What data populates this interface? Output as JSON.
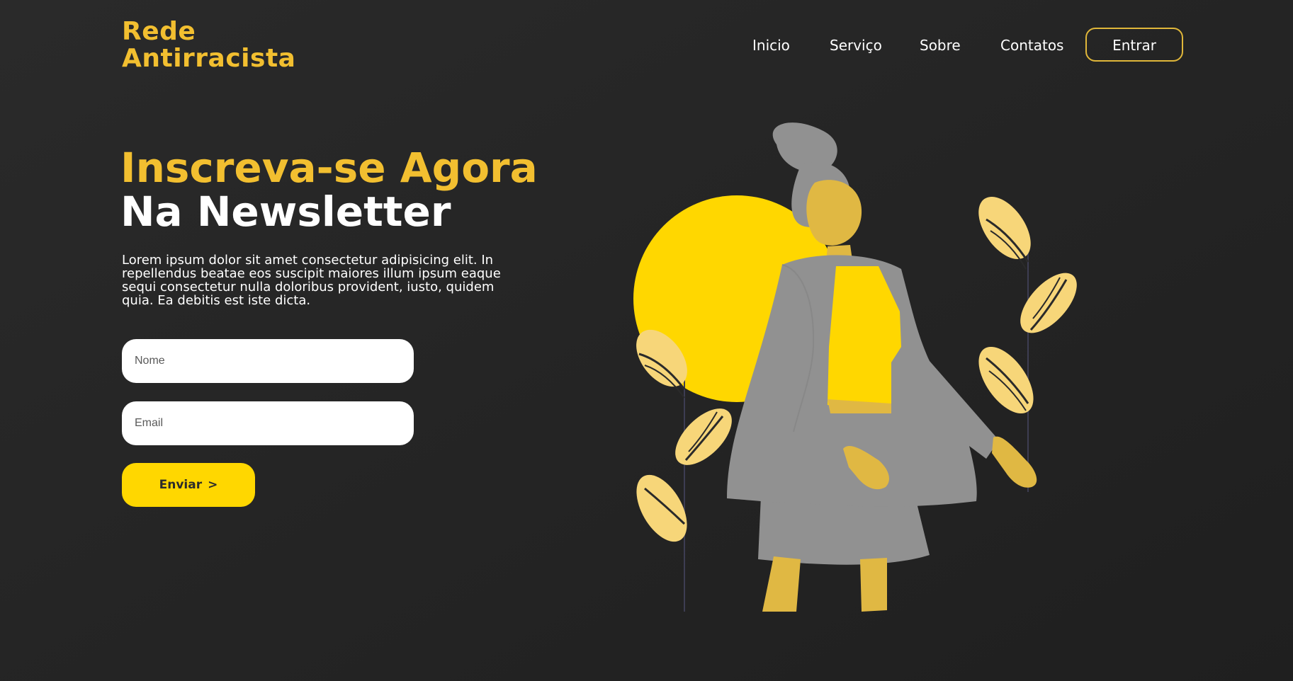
{
  "brand": {
    "line1": "Rede",
    "line2": "Antirracista"
  },
  "nav": {
    "items": [
      {
        "label": "Inicio"
      },
      {
        "label": "Serviço"
      },
      {
        "label": "Sobre"
      },
      {
        "label": "Contatos"
      }
    ],
    "login_label": "Entrar"
  },
  "hero": {
    "title_line1": "Inscreva-se Agora",
    "title_line2": "Na Newsletter",
    "description": "Lorem ipsum dolor sit amet consectetur adipisicing elit. In repellendus beatae eos suscipit maiores illum ipsum eaque sequi consectetur nulla doloribus provident, iusto, quidem quia. Ea debitis est iste dicta."
  },
  "form": {
    "name_placeholder": "Nome",
    "email_placeholder": "Email",
    "submit_label": "Enviar",
    "submit_arrow": ">"
  },
  "colors": {
    "background": "#252525",
    "accent_gold": "#f2bf30",
    "accent_yellow": "#ffd700",
    "figure_gray": "#919191",
    "skin": "#e0b843",
    "leaf": "#f7d679"
  },
  "illustration": {
    "name": "woman-with-sun-and-plants-illustration"
  }
}
